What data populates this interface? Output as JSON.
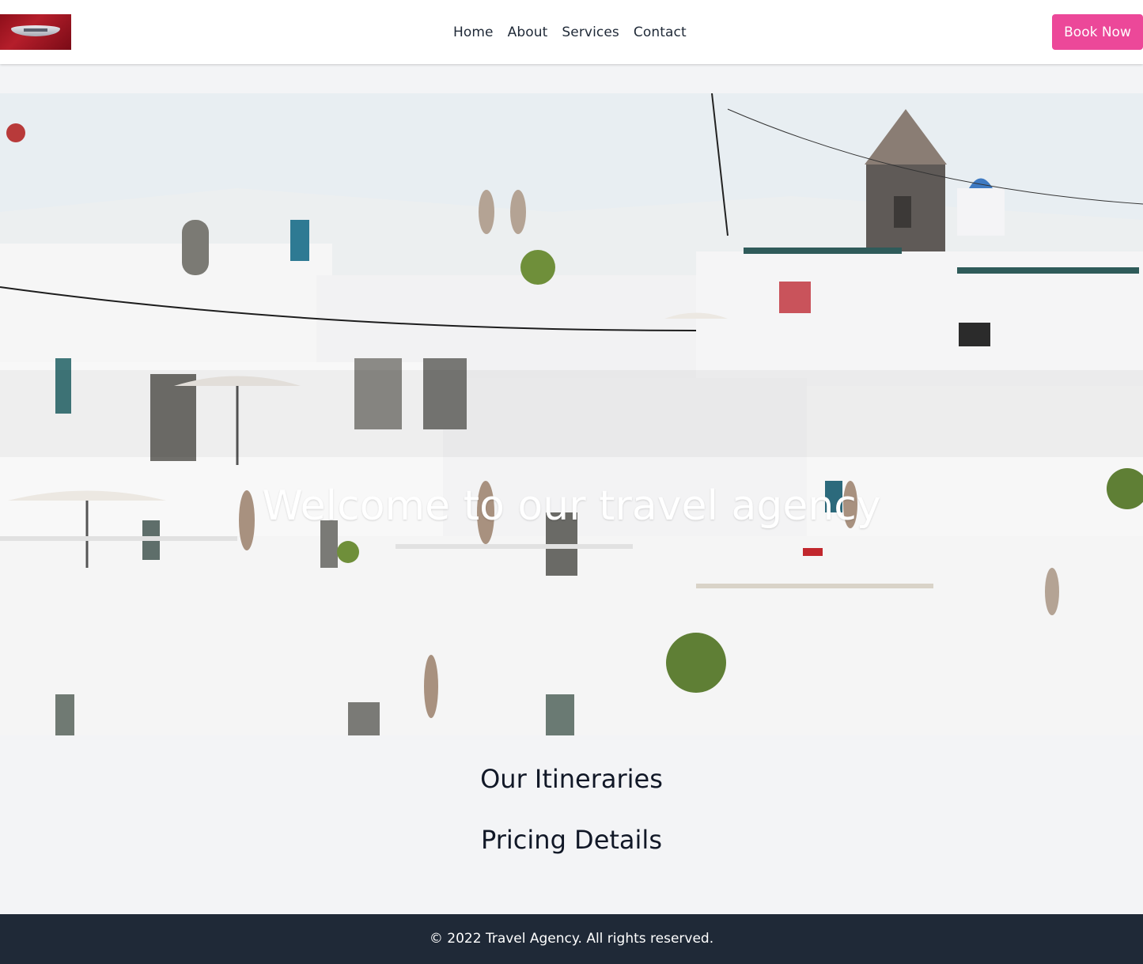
{
  "nav": {
    "logo_alt": "Aston Martin wings logo",
    "links": [
      {
        "label": "Home"
      },
      {
        "label": "About"
      },
      {
        "label": "Services"
      },
      {
        "label": "Contact"
      }
    ],
    "cta_label": "Book Now"
  },
  "hero": {
    "title": "Welcome to our travel agency",
    "image_subject": "whitewashed hillside village with terraces and umbrellas"
  },
  "sections": {
    "itineraries_heading": "Our Itineraries",
    "pricing_heading": "Pricing Details"
  },
  "footer": {
    "copyright": "© 2022 Travel Agency. All rights reserved."
  },
  "colors": {
    "accent": "#ec4899",
    "footer_bg": "#1f2937",
    "page_bg": "#f3f4f6",
    "nav_bg": "#ffffff",
    "logo_red": "#8e0f1a"
  }
}
